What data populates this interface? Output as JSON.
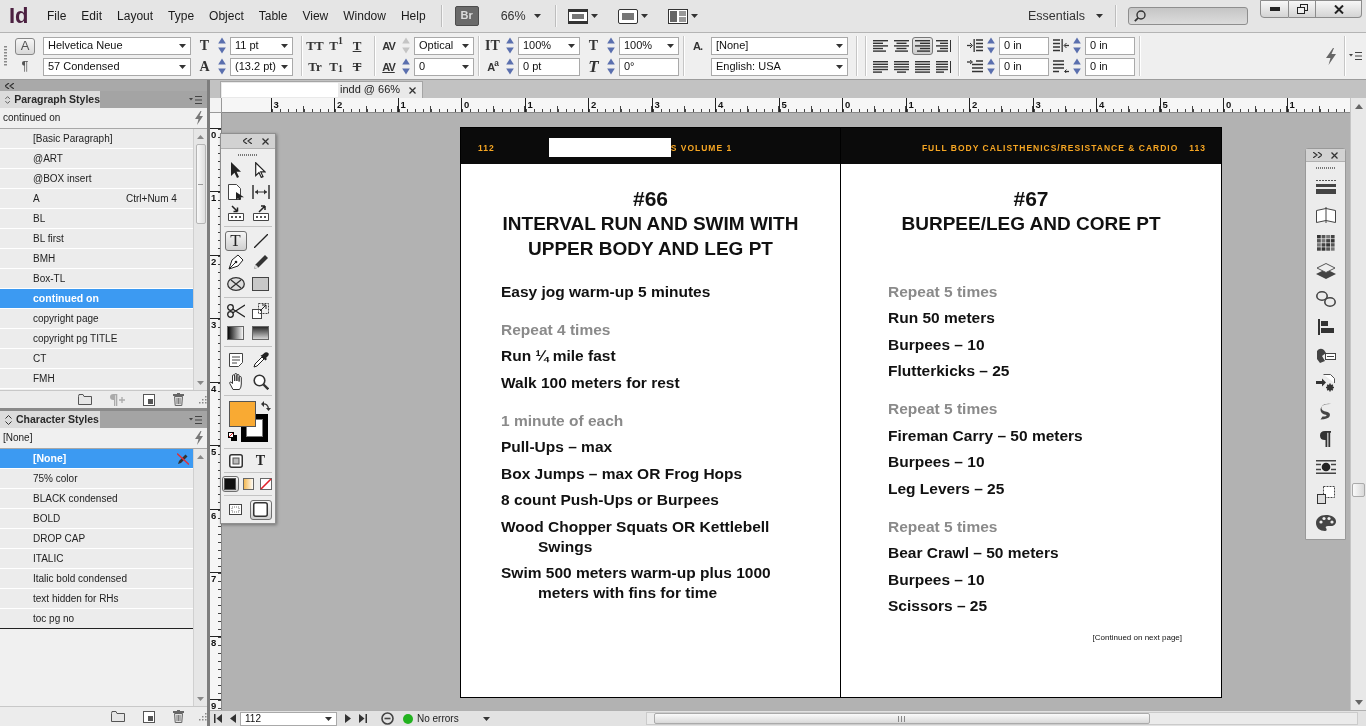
{
  "menubar": {
    "logo": "Id",
    "menus": [
      "File",
      "Edit",
      "Layout",
      "Type",
      "Object",
      "Table",
      "View",
      "Window",
      "Help"
    ],
    "bridge": "Br",
    "zoom": "66%",
    "workspace": "Essentials"
  },
  "control_panel": {
    "modes": [
      {
        "label": "A",
        "selected": true
      },
      {
        "label": "¶",
        "selected": false
      }
    ],
    "font": [
      "Helvetica Neue",
      "57 Condensed"
    ],
    "size_fields": [
      {
        "icon": "T",
        "value": "11 pt",
        "kind": "dropdown"
      },
      {
        "icon": "A",
        "value": "(13.2 pt)",
        "kind": "dropdown"
      }
    ],
    "type_styles": [
      {
        "label": "TT",
        "kind": "plain"
      },
      {
        "label": "T$^{1}$",
        "kind": "plain"
      },
      {
        "label": "T",
        "kind": "underline"
      },
      {
        "label": "Tr",
        "kind": "plain"
      },
      {
        "label": "T$_{1}$",
        "kind": "plain"
      },
      {
        "label": "T",
        "kind": "strikethrough"
      }
    ],
    "spacing_fields": [
      {
        "icon": "AV",
        "value": "Optical",
        "kind": "dropdown",
        "disabled": true
      },
      {
        "icon": "AV",
        "value": "0",
        "kind": "dropdown",
        "disabled": false
      }
    ],
    "scale_fields": [
      {
        "icon": "IT",
        "value": "100%",
        "kind": "dropdown"
      },
      {
        "icon": "A$^{a}$",
        "value": "0 pt",
        "kind": "input"
      }
    ],
    "transform_fields": [
      {
        "icon": "T",
        "value": "100%",
        "kind": "dropdown"
      },
      {
        "icon": "T",
        "value": "0°",
        "kind": "input"
      }
    ],
    "style_fields": [
      {
        "icon": "A.",
        "value": "[None]"
      },
      {
        "value": "English: USA"
      }
    ],
    "alignments": [
      {
        "kind": "left",
        "selected": false
      },
      {
        "kind": "center",
        "selected": false
      },
      {
        "kind": "right",
        "selected": true
      },
      {
        "kind": "towards-spine",
        "selected": false
      },
      {
        "kind": "justify-left",
        "selected": false
      },
      {
        "kind": "justify-center",
        "selected": false
      },
      {
        "kind": "justify-all",
        "selected": false
      },
      {
        "kind": "away-from-spine",
        "selected": false
      }
    ],
    "indent_fields": [
      "0 in",
      "0 in",
      "0 in",
      "0 in"
    ]
  },
  "paragraph_styles": {
    "title": "Paragraph Styles",
    "current": "continued on",
    "items": [
      {
        "name": "[Basic Paragraph]",
        "selected": false
      },
      {
        "name": "@ART",
        "selected": false
      },
      {
        "name": "@BOX insert",
        "selected": false
      },
      {
        "name": "A",
        "shortcut": "Ctrl+Num 4",
        "selected": false
      },
      {
        "name": "BL",
        "selected": false
      },
      {
        "name": "BL first",
        "selected": false
      },
      {
        "name": "BMH",
        "selected": false
      },
      {
        "name": "Box-TL",
        "selected": false
      },
      {
        "name": "continued on",
        "selected": true
      },
      {
        "name": "copyright page",
        "selected": false
      },
      {
        "name": "copyright pg TITLE",
        "selected": false
      },
      {
        "name": "CT",
        "selected": false
      },
      {
        "name": "FMH",
        "selected": false
      }
    ]
  },
  "character_styles": {
    "title": "Character Styles",
    "current": "[None]",
    "items": [
      {
        "name": "[None]",
        "selected": true,
        "editable": false
      },
      {
        "name": "75% color",
        "selected": false,
        "editable": true
      },
      {
        "name": "BLACK condensed",
        "selected": false,
        "editable": true
      },
      {
        "name": "BOLD",
        "selected": false,
        "editable": true
      },
      {
        "name": "DROP CAP",
        "selected": false,
        "editable": true
      },
      {
        "name": "ITALIC",
        "selected": false,
        "editable": true
      },
      {
        "name": "Italic bold condensed",
        "selected": false,
        "editable": true
      },
      {
        "name": "text hidden for RHs",
        "selected": false,
        "editable": true
      },
      {
        "name": "toc pg no",
        "selected": false,
        "editable": true
      }
    ]
  },
  "document": {
    "tab": {
      "title": "indd @ 66%",
      "covered": true
    },
    "horizontal_ruler": [
      "3",
      "2",
      "1",
      "0",
      "1",
      "2",
      "3",
      "4",
      "5",
      "0",
      "1",
      "2",
      "3",
      "4",
      "5",
      "0",
      "1"
    ],
    "vertical_ruler": [
      "0",
      "1",
      "2",
      "3",
      "4",
      "5",
      "6",
      "7",
      "8",
      "9"
    ],
    "pages": [
      {
        "folio": "112",
        "running_head": "S VOLUME 1",
        "covered": true,
        "number": "#66",
        "title": "INTERVAL RUN AND SWIM WITH UPPER BODY AND LEG PT",
        "groups": [
          {
            "items": [
              "Easy jog warm-up 5 minutes"
            ]
          },
          {
            "heading": "Repeat 4 times",
            "items": [
              "Run ¼ mile fast",
              "Walk 100 meters for rest"
            ]
          },
          {
            "heading": "1 minute of each",
            "items": [
              "Pull-Ups – max",
              "Box Jumps – max OR Frog Hops",
              "8 count Push-Ups or Burpees",
              "Wood Chopper Squats OR Kettlebell Swings",
              "Swim 500 meters warm-up plus 1000 meters with fins for time"
            ]
          }
        ]
      },
      {
        "folio": "113",
        "running_head": "FULL BODY CALISTHENICS/RESISTANCE & CARDIO",
        "covered": false,
        "number": "#67",
        "title": "BURPEE/LEG AND CORE PT",
        "groups": [
          {
            "heading": "Repeat 5 times",
            "items": [
              "Run 50 meters",
              "Burpees – 10",
              "Flutterkicks – 25"
            ]
          },
          {
            "heading": "Repeat 5 times",
            "items": [
              "Fireman Carry – 50 meters",
              "Burpees – 10",
              "Leg Levers – 25"
            ]
          },
          {
            "heading": "Repeat 5 times",
            "items": [
              "Bear Crawl – 50 meters",
              "Burpees – 10",
              "Scissors – 25"
            ]
          }
        ],
        "note": "[Continued on next page]"
      }
    ]
  },
  "tools_panel": {
    "tool_groups": [
      [
        {
          "kind": "selection",
          "selected": false
        },
        {
          "kind": "direct-selection",
          "selected": false
        },
        {
          "kind": "page",
          "selected": false
        },
        {
          "kind": "gap",
          "selected": false
        },
        {
          "kind": "content-collector",
          "selected": false
        },
        {
          "kind": "content-placer",
          "selected": false
        }
      ],
      [
        {
          "kind": "type",
          "label": "T",
          "selected": true
        },
        {
          "kind": "line",
          "selected": false
        },
        {
          "kind": "pen",
          "selected": false
        },
        {
          "kind": "pencil",
          "selected": false
        },
        {
          "kind": "rectangle-frame",
          "selected": false
        },
        {
          "kind": "rectangle",
          "selected": false
        }
      ],
      [
        {
          "kind": "scissors",
          "selected": false
        },
        {
          "kind": "free-transform",
          "selected": false
        },
        {
          "kind": "gradient-swatch",
          "selected": false
        },
        {
          "kind": "gradient-feather",
          "selected": false
        }
      ],
      [
        {
          "kind": "note",
          "selected": false
        },
        {
          "kind": "eyedropper",
          "selected": false
        },
        {
          "kind": "hand",
          "selected": false
        },
        {
          "kind": "zoom",
          "selected": false
        }
      ]
    ],
    "swatches": [
      {
        "kind": "fill",
        "color": "#f9aa33"
      },
      {
        "kind": "stroke",
        "color": "#000000"
      }
    ],
    "format_targets": [
      {
        "kind": "container"
      },
      {
        "kind": "text",
        "label": "T"
      }
    ],
    "apply": [
      {
        "kind": "color",
        "selected": true
      },
      {
        "kind": "gradient",
        "selected": false
      },
      {
        "kind": "none",
        "selected": false
      }
    ],
    "view_modes": [
      {
        "kind": "normal",
        "selected": false
      },
      {
        "kind": "preview",
        "selected": true
      }
    ]
  },
  "status_bar": {
    "page": "112",
    "preflight": {
      "text": "No errors",
      "ok": true
    }
  }
}
